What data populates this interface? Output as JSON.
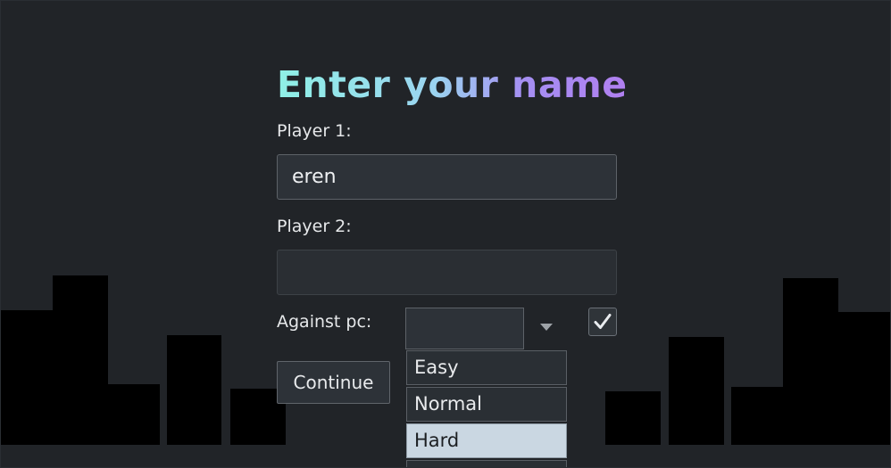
{
  "page": {
    "title": "Enter your name"
  },
  "form": {
    "player1_label": "Player 1:",
    "player1_value": "eren",
    "player2_label": "Player 2:",
    "player2_value": "",
    "against_pc_label": "Against pc:",
    "against_pc_checked": true,
    "difficulty_selected": "",
    "difficulty_options": [
      "Easy",
      "Normal",
      "Hard"
    ],
    "highlighted_option": "Hard",
    "continue_label": "Continue"
  },
  "colors": {
    "background": "#212428",
    "skyline": "#000000",
    "title_gradient": [
      "#8ff0e6",
      "#a58ff2",
      "#b07ff0"
    ],
    "option_highlight": "#cad7e2"
  },
  "icons": {
    "checkbox": "checkmark-icon",
    "select": "chevron-down-icon"
  }
}
